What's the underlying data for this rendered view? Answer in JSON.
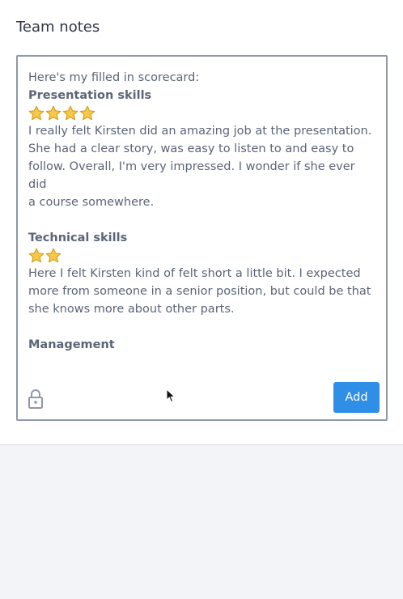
{
  "panel": {
    "title": "Team notes"
  },
  "editor": {
    "intro": "Here's my filled in scorecard:",
    "sections": [
      {
        "heading": "Presentation skills",
        "stars": 4,
        "body_lines": [
          "I really felt Kirsten did an amazing job at the presentation.",
          "She had a clear story, was easy to listen to and easy to",
          "follow. Overall, I'm very impressed. I wonder if she ever did",
          "a course somewhere."
        ]
      },
      {
        "heading": "Technical skills",
        "stars": 2,
        "body_lines": [
          "Here I felt Kirsten kind of felt short a little bit. I expected",
          "more from someone in a senior position, but could be that",
          "she knows more about other parts."
        ]
      },
      {
        "heading": "Management"
      }
    ]
  },
  "actions": {
    "add_label": "Add",
    "lock_icon": "lock-icon"
  },
  "colors": {
    "accent": "#2f8fe6",
    "star_fill": "#f6c94a",
    "star_stroke": "#d79a14",
    "text": "#5b6577"
  }
}
